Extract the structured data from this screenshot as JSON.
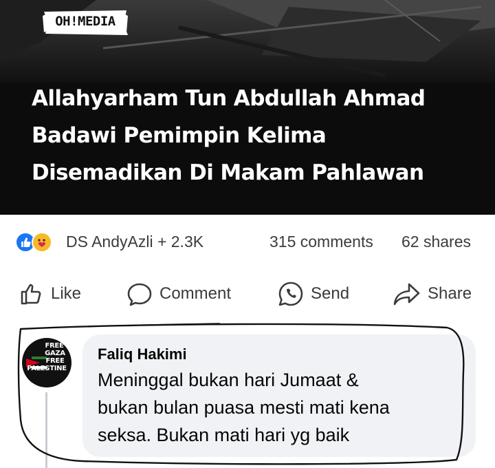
{
  "hero": {
    "logo": "OH!MEDIA",
    "headline_lines": [
      "Allahyarham Tun Abdullah Ahmad",
      "Badawi Pemimpin Kelima",
      "Disemadikan Di Makam Pahlawan"
    ]
  },
  "reactions": {
    "names": "DS AndyAzli + 2.3K",
    "comments": "315 comments",
    "shares": "62 shares",
    "icons": [
      "like-reaction-icon",
      "care-reaction-icon"
    ]
  },
  "actions": {
    "like": "Like",
    "comment": "Comment",
    "send": "Send",
    "share": "Share"
  },
  "comment": {
    "avatar_lines": [
      "FREE",
      "GAZA",
      "FREE",
      "PALESTINE"
    ],
    "author": "Faliq Hakimi",
    "text_lines": [
      "Meninggal bukan hari Jumaat &",
      "bukan bulan puasa mesti mati kena",
      "seksa. Bukan mati hari yg baik"
    ]
  },
  "colors": {
    "like_blue": "#1877f2",
    "care_yellow": "#f7b928",
    "bubble_bg": "#f0f2f5",
    "text_secondary": "#3a3b3c"
  }
}
